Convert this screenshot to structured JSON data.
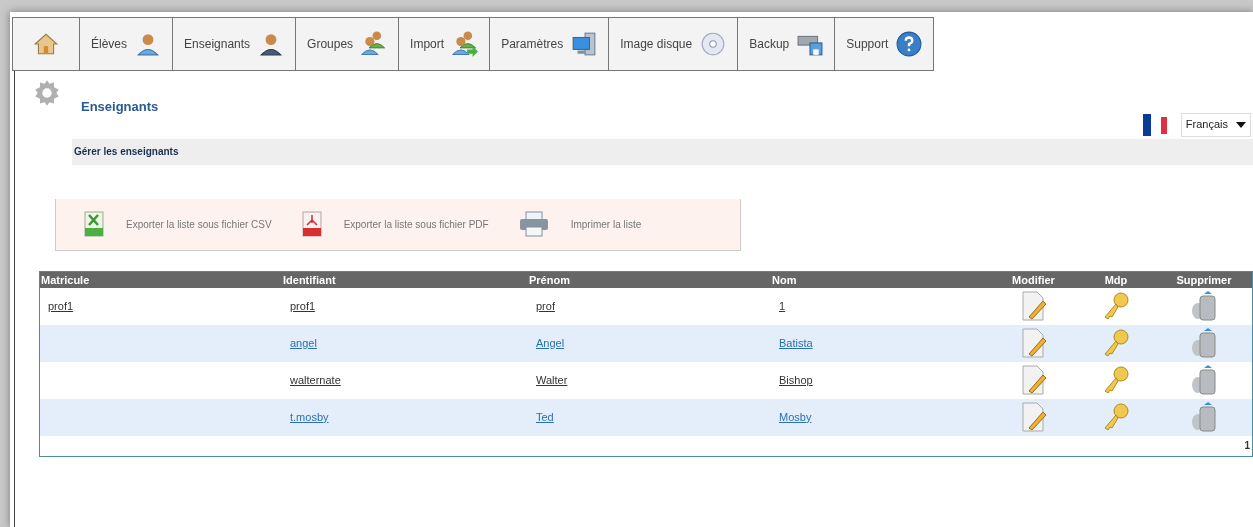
{
  "nav": [
    {
      "kind": "home"
    },
    {
      "kind": "student",
      "label": "Élèves"
    },
    {
      "kind": "teacher",
      "label": "Enseignants"
    },
    {
      "kind": "group",
      "label": "Groupes"
    },
    {
      "kind": "import",
      "label": "Import"
    },
    {
      "kind": "settings",
      "label": "Paramètres"
    },
    {
      "kind": "disc",
      "label": "Image disque"
    },
    {
      "kind": "backup",
      "label": "Backup"
    },
    {
      "kind": "support",
      "label": "Support"
    }
  ],
  "page_title": "Enseignants",
  "language": {
    "value": "Français"
  },
  "section_title": "Gérer les enseignants",
  "actions": [
    {
      "kind": "xls",
      "label": "Exporter la liste sous fichier CSV"
    },
    {
      "kind": "pdf",
      "label": "Exporter la liste sous fichier PDF"
    },
    {
      "kind": "print",
      "label": "Imprimer la liste"
    }
  ],
  "table": {
    "columns": [
      "Matricule",
      "Identifiant",
      "Prénom",
      "Nom",
      "Modifier",
      "Mdp",
      "Supprimer"
    ],
    "rows": [
      {
        "highlighted": false,
        "cells": [
          "prof1",
          "prof1",
          "prof",
          "1"
        ]
      },
      {
        "highlighted": true,
        "cells": [
          "",
          "angel",
          "Angel",
          "Batista"
        ]
      },
      {
        "highlighted": false,
        "cells": [
          "",
          "walternate",
          "Walter",
          "Bishop"
        ]
      },
      {
        "highlighted": true,
        "cells": [
          "",
          "t.mosby",
          "Ted",
          "Mosby"
        ]
      }
    ],
    "pagination": "1"
  }
}
